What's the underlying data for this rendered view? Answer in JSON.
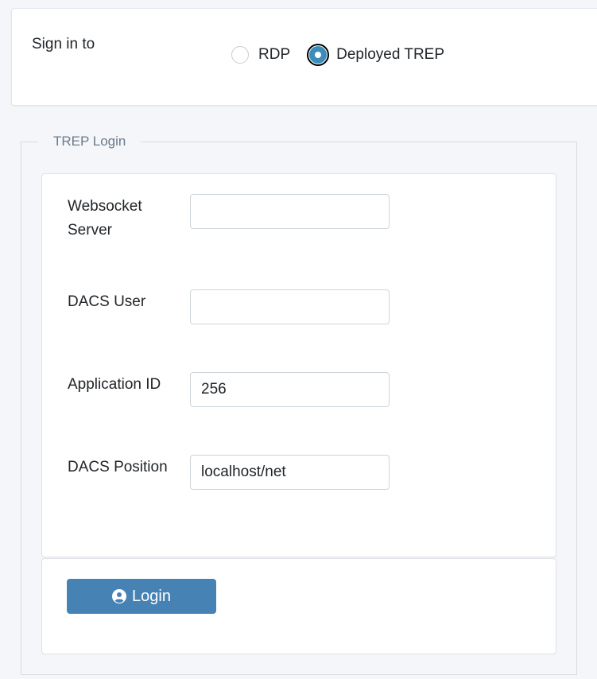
{
  "signin": {
    "label": "Sign in to",
    "options": [
      {
        "label": "RDP",
        "selected": false
      },
      {
        "label": "Deployed TREP",
        "selected": true
      }
    ]
  },
  "trep": {
    "legend": "TREP Login",
    "fields": {
      "websocket_server": {
        "label": "Websocket Server",
        "value": ""
      },
      "dacs_user": {
        "label": "DACS User",
        "value": ""
      },
      "application_id": {
        "label": "Application ID",
        "value": "256"
      },
      "dacs_position": {
        "label": "DACS Position",
        "value": "localhost/net"
      }
    },
    "login_button": {
      "label": "Login",
      "icon": "user-circle-icon"
    }
  },
  "colors": {
    "accent": "#3c8dbc",
    "button": "#4682b4",
    "background": "#f4f6f9"
  }
}
